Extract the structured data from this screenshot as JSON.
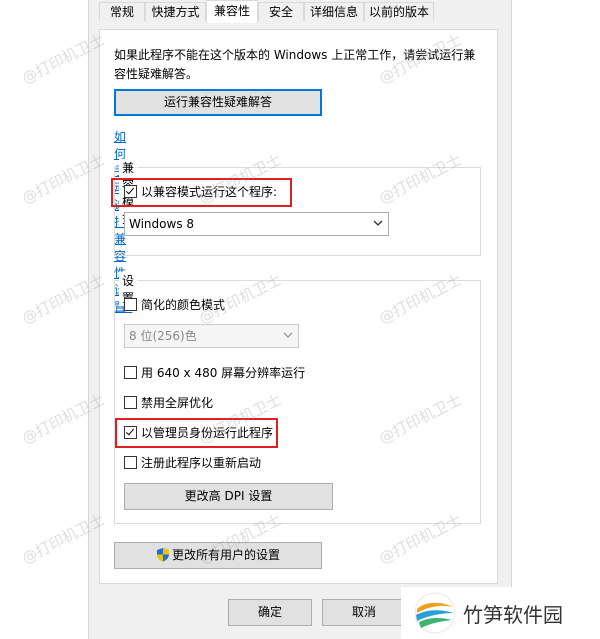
{
  "tabs": [
    "常规",
    "快捷方式",
    "兼容性",
    "安全",
    "详细信息",
    "以前的版本"
  ],
  "active_tab": "兼容性",
  "description": "如果此程序不能在这个版本的 Windows 上正常工作，请尝试运行兼容性疑难解答。",
  "troubleshooter_button": "运行兼容性疑难解答",
  "manual_link": "如何手动选择兼容性设置?",
  "compat_mode": {
    "title": "兼容模式",
    "checkbox_label": "以兼容模式运行这个程序:",
    "checked": true,
    "selected_os": "Windows 8"
  },
  "settings": {
    "title": "设置",
    "reduced_color_label": "简化的颜色模式",
    "color_depth": "8 位(256)色",
    "resolution_label": "用 640 x 480 屏幕分辨率运行",
    "fullscreen_label": "禁用全屏优化",
    "admin_label": "以管理员身份运行此程序",
    "admin_checked": true,
    "restart_label": "注册此程序以重新启动",
    "dpi_button": "更改高 DPI 设置"
  },
  "all_users_button": "更改所有用户的设置",
  "ok_button": "确定",
  "cancel_button": "取消",
  "watermark": "@打印机卫士",
  "brand": "竹笋软件园",
  "colors": {
    "highlight": "#e02020",
    "link": "#0066cc",
    "focus": "#0078d7"
  }
}
